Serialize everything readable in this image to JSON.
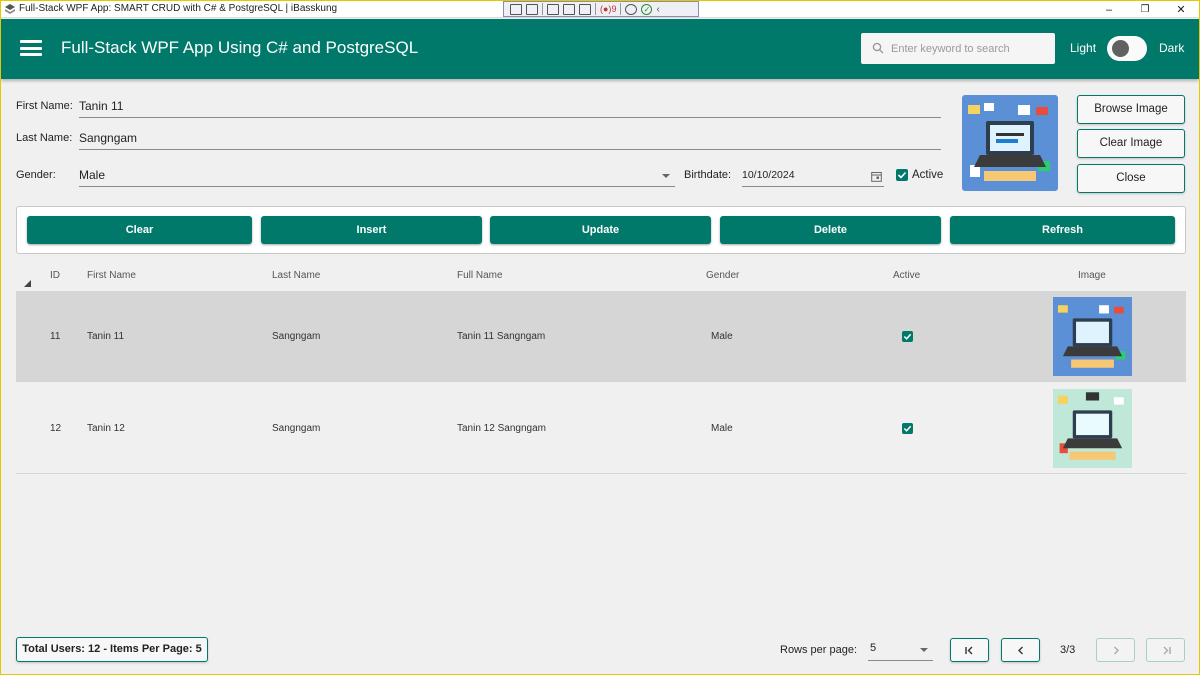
{
  "window": {
    "title": "Full-Stack WPF App: SMART CRUD with C# & PostgreSQL | iBasskung",
    "debug_count": "9",
    "minimize_glyph": "–",
    "maximize_glyph": "❐",
    "close_glyph": "✕"
  },
  "header": {
    "title": "Full-Stack WPF App Using C# and PostgreSQL",
    "search_placeholder": "Enter keyword to search",
    "theme_light": "Light",
    "theme_dark": "Dark",
    "dark_mode_on": false
  },
  "form": {
    "first_name_label": "First Name:",
    "first_name_value": "Tanin 11",
    "last_name_label": "Last Name:",
    "last_name_value": "Sangngam",
    "gender_label": "Gender:",
    "gender_value": "Male",
    "birthdate_label": "Birthdate:",
    "birthdate_value": "10/10/2024",
    "active_label": "Active",
    "active_checked": true
  },
  "image_buttons": {
    "browse": "Browse Image",
    "clear": "Clear Image",
    "close": "Close"
  },
  "actions": {
    "clear": "Clear",
    "insert": "Insert",
    "update": "Update",
    "delete": "Delete",
    "refresh": "Refresh"
  },
  "grid": {
    "columns": {
      "id": "ID",
      "first_name": "First Name",
      "last_name": "Last Name",
      "full_name": "Full Name",
      "gender": "Gender",
      "active": "Active",
      "image": "Image"
    },
    "rows": [
      {
        "id": "11",
        "first_name": "Tanin 11",
        "last_name": "Sangngam",
        "full_name": "Tanin 11 Sangngam",
        "gender": "Male",
        "active": true,
        "selected": true,
        "image_theme": "blue"
      },
      {
        "id": "12",
        "first_name": "Tanin 12",
        "last_name": "Sangngam",
        "full_name": "Tanin 12 Sangngam",
        "gender": "Male",
        "active": true,
        "selected": false,
        "image_theme": "green"
      }
    ]
  },
  "footer": {
    "total_text": "Total Users: 12 - Items Per Page: 5",
    "rows_per_page_label": "Rows per page:",
    "rows_per_page_value": "5",
    "page_indicator": "3/3"
  },
  "colors": {
    "primary": "#00796b",
    "selected_row": "#d6d6d6",
    "background": "#f0f0f0"
  },
  "icons": [
    "app-icon",
    "hamburger-icon",
    "search-icon",
    "calendar-icon",
    "check-icon",
    "dropdown-arrow-icon",
    "first-page-icon",
    "prev-page-icon",
    "next-page-icon",
    "last-page-icon"
  ]
}
